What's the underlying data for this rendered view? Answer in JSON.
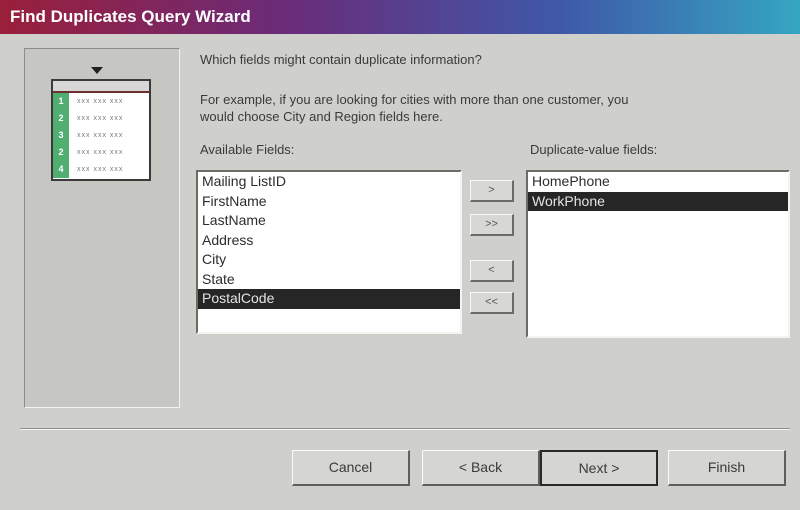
{
  "window": {
    "title": "Find Duplicates Query Wizard"
  },
  "instructions": {
    "question": "Which fields might contain duplicate information?",
    "example_line1": "For example, if you are looking for cities with more than one customer, you",
    "example_line2": "would choose City and Region fields here."
  },
  "available": {
    "label": "Available Fields:",
    "items": [
      "Mailing ListID",
      "FirstName",
      "LastName",
      "Address",
      "City",
      "State",
      "PostalCode"
    ],
    "selected_index": 6
  },
  "duplicate": {
    "label": "Duplicate-value fields:",
    "items": [
      "HomePhone",
      "WorkPhone"
    ],
    "selected_index": 1
  },
  "move_buttons": {
    "add": ">",
    "add_all": ">>",
    "remove": "<",
    "remove_all": "<<"
  },
  "buttons": {
    "cancel": "Cancel",
    "back": "< Back",
    "next": "Next >",
    "finish": "Finish"
  },
  "wizard_graphic": {
    "row_numbers": [
      "1",
      "2",
      "3",
      "2",
      "4"
    ],
    "cell_text": "xxx xxx xxx"
  },
  "colors": {
    "title_gradient_start": "#9a1f3a",
    "title_gradient_end": "#35a6c2",
    "selection": "#262626",
    "graphic_accent": "#4fae70"
  }
}
